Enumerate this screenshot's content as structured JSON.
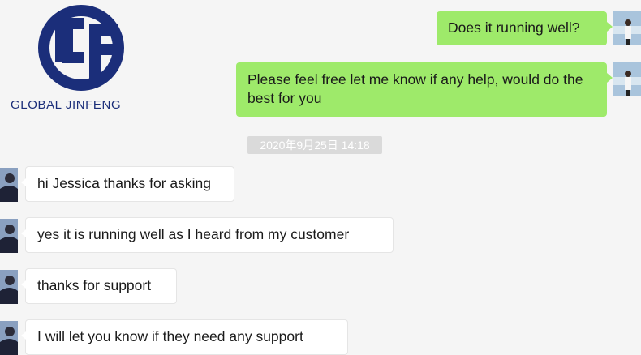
{
  "logo": {
    "text": "GLOBAL JINFENG",
    "color": "#1b2e7a"
  },
  "messages": [
    {
      "direction": "outgoing",
      "text": "Does it running well?"
    },
    {
      "direction": "outgoing",
      "text": "Please feel free let me know if any help, would do the best for you"
    },
    {
      "direction": "incoming",
      "text": "hi Jessica thanks for asking"
    },
    {
      "direction": "incoming",
      "text": "yes it is running well as I heard from my customer"
    },
    {
      "direction": "incoming",
      "text": "thanks for support"
    },
    {
      "direction": "incoming",
      "text": "I will let you know if they need any support"
    }
  ],
  "timestamp": "2020年9月25日 14:18",
  "colors": {
    "outgoing_bubble": "#9eea6a",
    "incoming_bubble": "#ffffff",
    "timestamp_bg": "#dadada",
    "background": "#f5f5f5"
  }
}
